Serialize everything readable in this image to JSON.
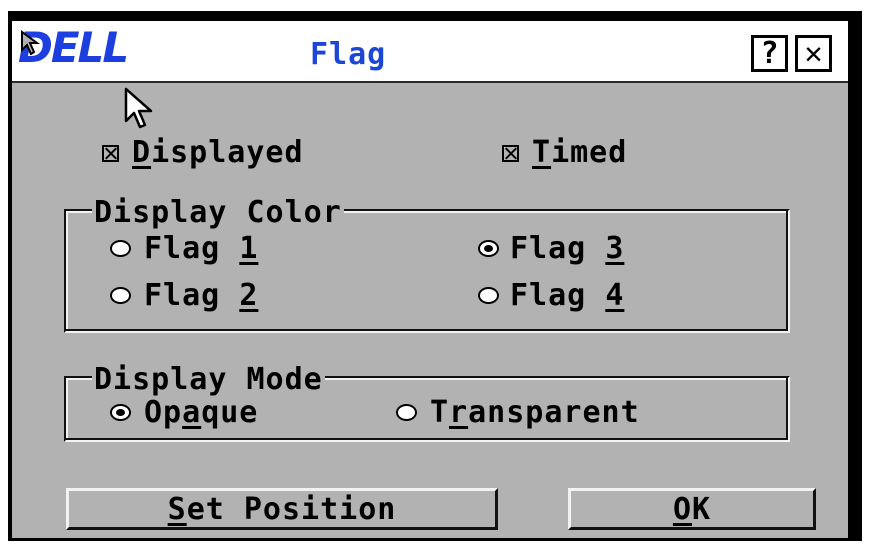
{
  "window": {
    "logo": "DELL",
    "title": "Flag",
    "help_label": "?",
    "close_label": "✕"
  },
  "options": {
    "displayed": {
      "label_u": "D",
      "label_rest": "isplayed",
      "checked": true
    },
    "timed": {
      "label_u": "T",
      "label_rest": "imed",
      "checked": true
    }
  },
  "display_color": {
    "title": "Display Color",
    "flag1": {
      "label_pre": "Flag ",
      "label_u": "1",
      "selected": false
    },
    "flag2": {
      "label_pre": "Flag ",
      "label_u": "2",
      "selected": false
    },
    "flag3": {
      "label_pre": "Flag ",
      "label_u": "3",
      "selected": true
    },
    "flag4": {
      "label_pre": "Flag ",
      "label_u": "4",
      "selected": false
    }
  },
  "display_mode": {
    "title": "Display Mode",
    "opaque": {
      "label_pre": "Op",
      "label_u": "a",
      "label_post": "que",
      "selected": true
    },
    "transparent": {
      "label_pre": "T",
      "label_u": "r",
      "label_post": "ansparent",
      "selected": false
    }
  },
  "buttons": {
    "set_position": {
      "label_u": "S",
      "label_rest": "et Position"
    },
    "ok": {
      "label_u": "O",
      "label_rest": "K"
    }
  },
  "icons": {
    "logo": "dell-logo",
    "help": "help-icon",
    "close": "close-icon",
    "pointer": "mouse-pointer-icon"
  },
  "colors": {
    "title_text": "#1c46d6",
    "logo": "#1d3fe0",
    "dialog_bg": "#b2b2b2"
  }
}
